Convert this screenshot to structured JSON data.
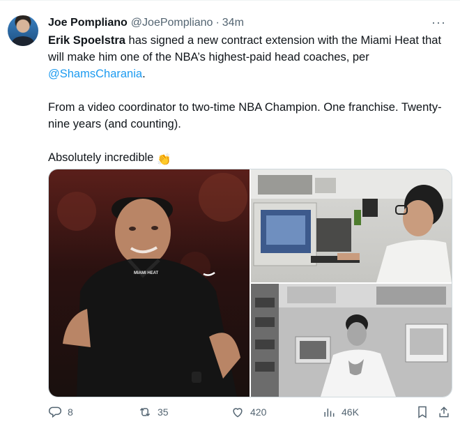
{
  "tweet": {
    "author_name": "Joe Pompliano",
    "handle": "@JoePompliano",
    "separator": "·",
    "time": "34m",
    "more": "···",
    "text": {
      "line1_bold": "Erik Spoelstra",
      "line1_rest": " has signed a new contract extension with the Miami Heat that will make him one of the NBA’s highest-paid head coaches, per",
      "mention": "@ShamsCharania",
      "mention_end": ".",
      "para2": "From a video coordinator to two-time NBA Champion. One franchise. Twenty-nine years (and counting).",
      "para3": "Absolutely incredible",
      "emoji": "👏"
    },
    "media": {
      "left_jersey_text": "MIAMI HEAT"
    },
    "actions": {
      "replies": "8",
      "retweets": "35",
      "likes": "420",
      "views": "46K"
    }
  },
  "colors": {
    "accent": "#1d9bf0",
    "muted": "#536471",
    "text": "#0f1419"
  },
  "icons": [
    "reply-icon",
    "retweet-icon",
    "like-icon",
    "views-icon",
    "bookmark-icon",
    "share-icon",
    "more-icon"
  ]
}
